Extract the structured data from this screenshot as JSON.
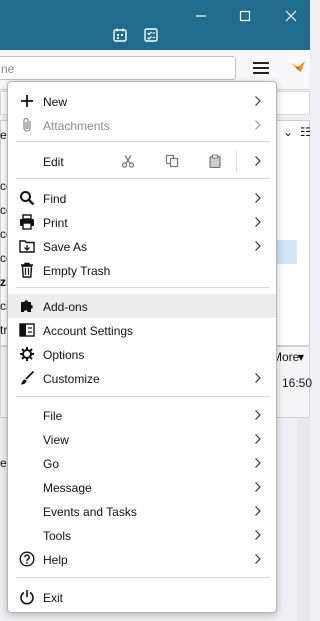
{
  "background": {
    "search_placeholder": "ne",
    "left_labels": [
      "es",
      "co",
      "co",
      "co",
      "co",
      "co",
      "zi",
      "cil",
      "tr",
      "e"
    ],
    "right_header": "More",
    "right_time": "16:50"
  },
  "menu": {
    "new": "New",
    "attachments": "Attachments",
    "edit": "Edit",
    "find": "Find",
    "print": "Print",
    "save_as": "Save As",
    "empty_trash": "Empty Trash",
    "addons": "Add-ons",
    "account_settings": "Account Settings",
    "options": "Options",
    "customize": "Customize",
    "file": "File",
    "view": "View",
    "go": "Go",
    "message": "Message",
    "events_tasks": "Events and Tasks",
    "tools": "Tools",
    "help": "Help",
    "exit": "Exit"
  },
  "colors": {
    "titlebar": "#1e6c8e",
    "menu_hover": "#ededf0"
  }
}
